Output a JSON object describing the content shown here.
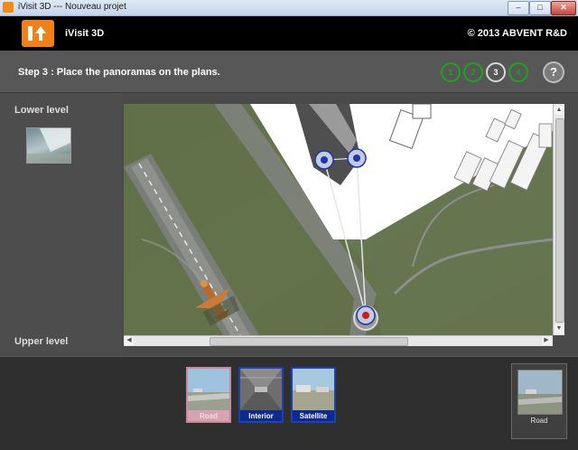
{
  "window": {
    "title": "iVisit 3D --- Nouveau projet",
    "controls": {
      "minimize": "–",
      "maximize": "□",
      "close": "✕"
    }
  },
  "header": {
    "app_name": "iVisit 3D",
    "copyright": "© 2013 ABVENT R&D",
    "logo_icon": "ivisit-logo-icon",
    "logo_color": "#f08118"
  },
  "stepbar": {
    "instruction": "Step 3 : Place the panoramas on the plans.",
    "steps": [
      "1",
      "2",
      "3",
      "4"
    ],
    "active_step": "3",
    "help_label": "?",
    "step_color": "#1fa21f"
  },
  "levels": {
    "lower_label": "Lower level",
    "upper_label": "Upper level"
  },
  "panoramas": [
    {
      "label": "Road",
      "selected": true
    },
    {
      "label": "Interior",
      "selected": false
    },
    {
      "label": "Satellite",
      "selected": false
    }
  ],
  "preview": {
    "label": "Road"
  },
  "scrollbars": {
    "up": "▲",
    "down": "▼",
    "left": "◀",
    "right": "▶"
  }
}
